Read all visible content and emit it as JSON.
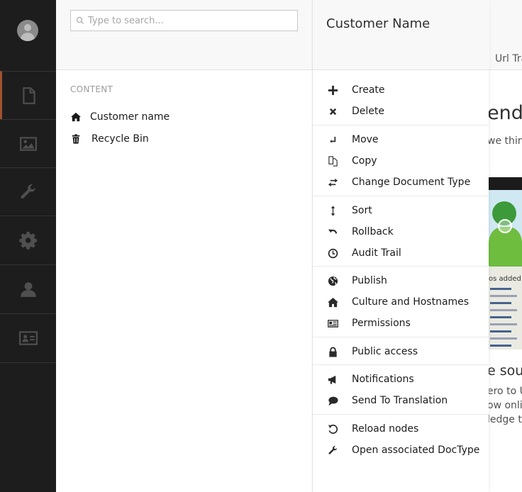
{
  "search": {
    "placeholder": "Type to search..."
  },
  "tree": {
    "section_title": "CONTENT",
    "nodes": [
      {
        "label": "Customer name",
        "icon": "home-icon"
      },
      {
        "label": "Recycle Bin",
        "icon": "trash-icon"
      }
    ]
  },
  "sidebar": {
    "items": [
      {
        "name": "content",
        "icon": "document-icon",
        "active": true
      },
      {
        "name": "media",
        "icon": "image-icon"
      },
      {
        "name": "settings",
        "icon": "wrench-icon"
      },
      {
        "name": "developer",
        "icon": "gear-icon"
      },
      {
        "name": "users",
        "icon": "user-icon"
      },
      {
        "name": "members",
        "icon": "id-card-icon"
      }
    ]
  },
  "menu": {
    "title": "Customer Name",
    "groups": [
      [
        {
          "label": "Create",
          "icon": "plus-icon"
        },
        {
          "label": "Delete",
          "icon": "x-icon"
        }
      ],
      [
        {
          "label": "Move",
          "icon": "move-icon"
        },
        {
          "label": "Copy",
          "icon": "copy-icon"
        },
        {
          "label": "Change Document Type",
          "icon": "exchange-icon"
        }
      ],
      [
        {
          "label": "Sort",
          "icon": "sort-icon"
        },
        {
          "label": "Rollback",
          "icon": "undo-icon"
        },
        {
          "label": "Audit Trail",
          "icon": "clock-icon"
        }
      ],
      [
        {
          "label": "Publish",
          "icon": "globe-icon"
        },
        {
          "label": "Culture and Hostnames",
          "icon": "home-icon"
        },
        {
          "label": "Permissions",
          "icon": "permissions-card-icon"
        }
      ],
      [
        {
          "label": "Public access",
          "icon": "lock-icon"
        }
      ],
      [
        {
          "label": "Notifications",
          "icon": "megaphone-icon"
        },
        {
          "label": "Send To Translation",
          "icon": "speech-bubble-icon"
        }
      ],
      [
        {
          "label": "Reload nodes",
          "icon": "reload-icon"
        },
        {
          "label": "Open associated DocType",
          "icon": "wrench-icon"
        }
      ]
    ]
  },
  "content": {
    "tab_label": "Url Tra",
    "heading": "endly",
    "subtext": "we thin",
    "video_caption": "os added",
    "heading2": "e sour",
    "lines": [
      "ero to U",
      "ow onli",
      "ledge to"
    ]
  },
  "colors": {
    "sidebar_bg": "#1d1d1d",
    "active_accent": "#a0522d",
    "panel_header_bg": "#f8f8f8"
  }
}
